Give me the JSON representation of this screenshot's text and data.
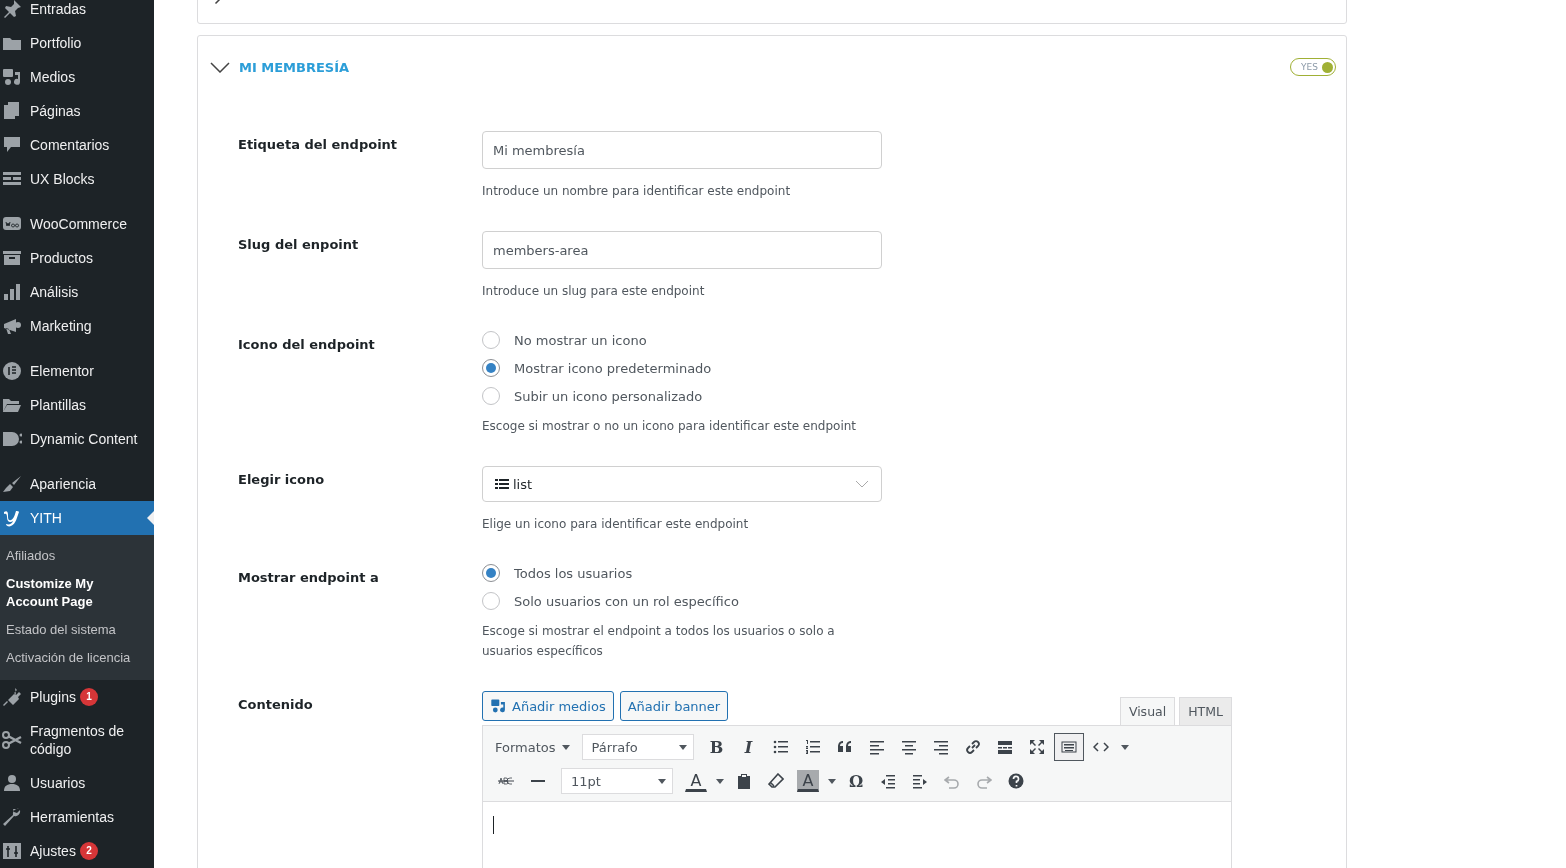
{
  "sidebar": {
    "groups": [
      [
        {
          "label": "Entradas",
          "selected": false
        },
        {
          "label": "Portfolio",
          "selected": false
        },
        {
          "label": "Medios",
          "selected": false
        },
        {
          "label": "Páginas",
          "selected": false
        },
        {
          "label": "Comentarios",
          "selected": false
        },
        {
          "label": "UX Blocks",
          "selected": false
        }
      ],
      [
        {
          "label": "WooCommerce",
          "selected": false
        },
        {
          "label": "Productos",
          "selected": false
        },
        {
          "label": "Análisis",
          "selected": false
        },
        {
          "label": "Marketing",
          "selected": false
        }
      ],
      [
        {
          "label": "Elementor",
          "selected": false
        },
        {
          "label": "Plantillas",
          "selected": false
        },
        {
          "label": "Dynamic Content",
          "selected": false
        }
      ],
      [
        {
          "label": "Apariencia",
          "selected": false
        },
        {
          "label": "YITH",
          "selected": true,
          "submenu": [
            {
              "label": "Afiliados",
              "selected": false
            },
            {
              "label": "Customize My Account Page",
              "selected": true
            },
            {
              "label": "Estado del sistema",
              "selected": false
            },
            {
              "label": "Activación de licencia",
              "selected": false
            }
          ]
        },
        {
          "label": "Plugins",
          "selected": false,
          "badge": "1"
        },
        {
          "label": "Fragmentos de código",
          "selected": false
        },
        {
          "label": "Usuarios",
          "selected": false
        },
        {
          "label": "Herramientas",
          "selected": false
        },
        {
          "label": "Ajustes",
          "selected": false,
          "badge": "2"
        }
      ]
    ]
  },
  "sections": [
    {
      "expanded": false
    },
    {
      "expanded": true,
      "title": "MI MEMBRESÍA",
      "toggle": {
        "on": true,
        "label": "YES"
      },
      "fields": [
        {
          "kind": "text",
          "label": "Etiqueta del endpoint",
          "value": "Mi membresía",
          "description": "Introduce un nombre para identificar este endpoint"
        },
        {
          "kind": "text",
          "label": "Slug del enpoint",
          "value": "members-area",
          "description": "Introduce un slug para este endpoint"
        },
        {
          "kind": "radio",
          "label": "Icono del endpoint",
          "options": [
            {
              "label": "No mostrar un icono",
              "selected": false
            },
            {
              "label": "Mostrar icono predeterminado",
              "selected": true
            },
            {
              "label": "Subir un icono personalizado",
              "selected": false
            }
          ],
          "description": "Escoge si mostrar o no un icono para identificar este endpoint"
        },
        {
          "kind": "select",
          "label": "Elegir icono",
          "value": "list",
          "description": "Elige un icono para identificar este endpoint"
        },
        {
          "kind": "radio",
          "label": "Mostrar endpoint a",
          "options": [
            {
              "label": "Todos los usuarios",
              "selected": true
            },
            {
              "label": "Solo usuarios con un rol específico",
              "selected": false
            }
          ],
          "description": "Escoge si mostrar el endpoint a todos los usuarios o solo a usuarios específicos"
        },
        {
          "kind": "editor",
          "label": "Contenido",
          "buttons": [
            "Añadir medios",
            "Añadir banner"
          ],
          "tabs": [
            {
              "label": "Visual",
              "selected": true
            },
            {
              "label": "HTML",
              "selected": false
            }
          ],
          "toolbar": [
            [
              {
                "kind": "menu",
                "label": "Formatos"
              },
              {
                "kind": "select",
                "value": "Párrafo"
              },
              {
                "kind": "glyph",
                "label": "B",
                "selected": false,
                "disabled": false
              },
              {
                "kind": "glyph",
                "label": "I",
                "selected": false,
                "disabled": false
              },
              {
                "kind": "icon",
                "selected": false,
                "disabled": false
              },
              {
                "kind": "icon",
                "selected": false,
                "disabled": false
              },
              {
                "kind": "icon",
                "selected": false,
                "disabled": false
              },
              {
                "kind": "icon",
                "selected": false,
                "disabled": false
              },
              {
                "kind": "icon",
                "selected": false,
                "disabled": false
              },
              {
                "kind": "icon",
                "selected": false,
                "disabled": false
              },
              {
                "kind": "icon",
                "selected": false,
                "disabled": false
              },
              {
                "kind": "icon",
                "selected": false,
                "disabled": false
              },
              {
                "kind": "icon",
                "selected": false,
                "disabled": false
              },
              {
                "kind": "icon",
                "selected": true,
                "disabled": false
              },
              {
                "kind": "icon",
                "selected": false,
                "disabled": false
              }
            ],
            [
              {
                "kind": "icon",
                "selected": false,
                "disabled": false
              },
              {
                "kind": "icon",
                "selected": false,
                "disabled": false
              },
              {
                "kind": "select",
                "value": "11pt"
              },
              {
                "kind": "color",
                "label": "A",
                "selected": false,
                "disabled": false
              },
              {
                "kind": "icon",
                "selected": false,
                "disabled": false
              },
              {
                "kind": "icon",
                "selected": false,
                "disabled": false
              },
              {
                "kind": "color",
                "label": "A",
                "selected": false,
                "disabled": false
              },
              {
                "kind": "glyph",
                "label": "Ω",
                "selected": false,
                "disabled": false
              },
              {
                "kind": "icon",
                "selected": false,
                "disabled": false
              },
              {
                "kind": "icon",
                "selected": false,
                "disabled": false
              },
              {
                "kind": "icon",
                "selected": false,
                "disabled": true
              },
              {
                "kind": "icon",
                "selected": false,
                "disabled": true
              },
              {
                "kind": "icon",
                "selected": false,
                "disabled": false
              }
            ]
          ]
        }
      ]
    }
  ]
}
